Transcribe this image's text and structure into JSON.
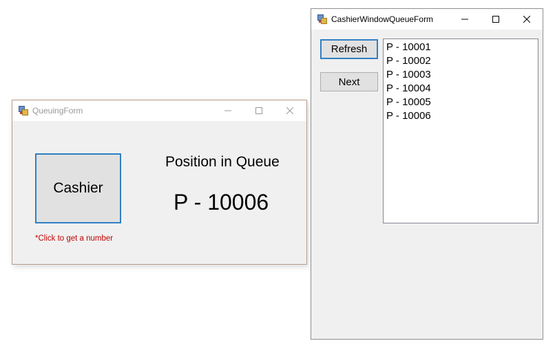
{
  "queuing_form": {
    "title": "QueuingForm",
    "cashier_button": "Cashier",
    "position_label": "Position in Queue",
    "position_value": "P - 10006",
    "hint": "*Click to get a number"
  },
  "cashier_window": {
    "title": "CashierWindowQueueForm",
    "refresh_button": "Refresh",
    "next_button": "Next",
    "queue": [
      "P - 10001",
      "P - 10002",
      "P - 10003",
      "P - 10004",
      "P - 10005",
      "P - 10006"
    ]
  },
  "icons": [
    "app-icon",
    "minimize-icon",
    "maximize-icon",
    "close-icon"
  ],
  "colors": {
    "accent": "#2f7fc3",
    "hint": "#c00000",
    "window": "#f0f0f0"
  }
}
